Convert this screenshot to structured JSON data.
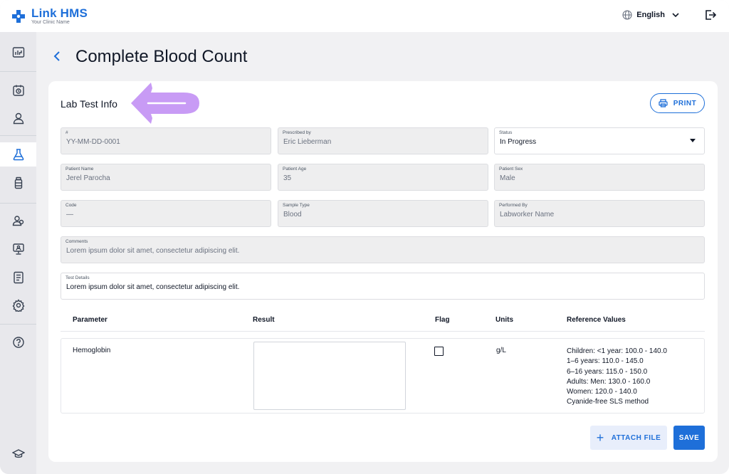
{
  "brand": {
    "name": "Link HMS",
    "subtitle": "Your Clinic Name",
    "accent": "#1e6fd9"
  },
  "header": {
    "language": "English",
    "language_icon": "globe-icon",
    "logout_icon": "logout-icon"
  },
  "sidebar": {
    "items": [
      {
        "icon": "dashboard-icon",
        "active": false
      },
      {
        "icon": "appointments-icon",
        "active": false
      },
      {
        "icon": "patient-icon",
        "active": false
      },
      {
        "icon": "lab-flask-icon",
        "active": true
      },
      {
        "icon": "pharmacy-bottle-icon",
        "active": false
      },
      {
        "icon": "staff-icon",
        "active": false
      },
      {
        "icon": "monitor-icon",
        "active": false
      },
      {
        "icon": "reports-icon",
        "active": false
      },
      {
        "icon": "settings-icon",
        "active": false
      },
      {
        "icon": "help-icon",
        "active": false
      },
      {
        "icon": "academy-icon",
        "active": false
      }
    ]
  },
  "page": {
    "title": "Complete Blood Count"
  },
  "card": {
    "section_title": "Lab Test Info",
    "print_label": "PRINT",
    "fields": {
      "number": {
        "label": "#",
        "value": "YY-MM-DD-0001"
      },
      "prescribed_by": {
        "label": "Prescribed by",
        "value": "Eric Lieberman"
      },
      "status": {
        "label": "Status",
        "value": "In Progress"
      },
      "patient_name": {
        "label": "Patient Name",
        "value": "Jerel Parocha"
      },
      "patient_age": {
        "label": "Patient Age",
        "value": "35"
      },
      "patient_sex": {
        "label": "Patient Sex",
        "value": "Male"
      },
      "code": {
        "label": "Code",
        "value": "—"
      },
      "sample_type": {
        "label": "Sample Type",
        "value": "Blood"
      },
      "performed_by": {
        "label": "Performed By",
        "value": "Labworker Name"
      },
      "comments": {
        "label": "Comments",
        "value": "Lorem ipsum dolor sit amet, consectetur adipiscing elit."
      },
      "test_details": {
        "label": "Test Details",
        "value": "Lorem ipsum dolor sit amet, consectetur adipiscing elit."
      }
    },
    "table": {
      "headers": [
        "Parameter",
        "Result",
        "Flag",
        "Units",
        "Reference Values"
      ],
      "rows": [
        {
          "parameter": "Hemoglobin",
          "result": "",
          "flag": false,
          "units": "g/L",
          "reference": [
            "Children: <1 year: 100.0 - 140.0",
            "1–6 years: 110.0 - 145.0",
            "6–16 years: 115.0 - 150.0",
            "Adults: Men: 130.0 - 160.0",
            "Women: 120.0 - 140.0",
            "Cyanide-free SLS method"
          ]
        }
      ]
    },
    "attach_label": "ATTACH FILE",
    "save_label": "SAVE"
  },
  "annotation": {
    "arrow_color": "#c89bf5"
  }
}
